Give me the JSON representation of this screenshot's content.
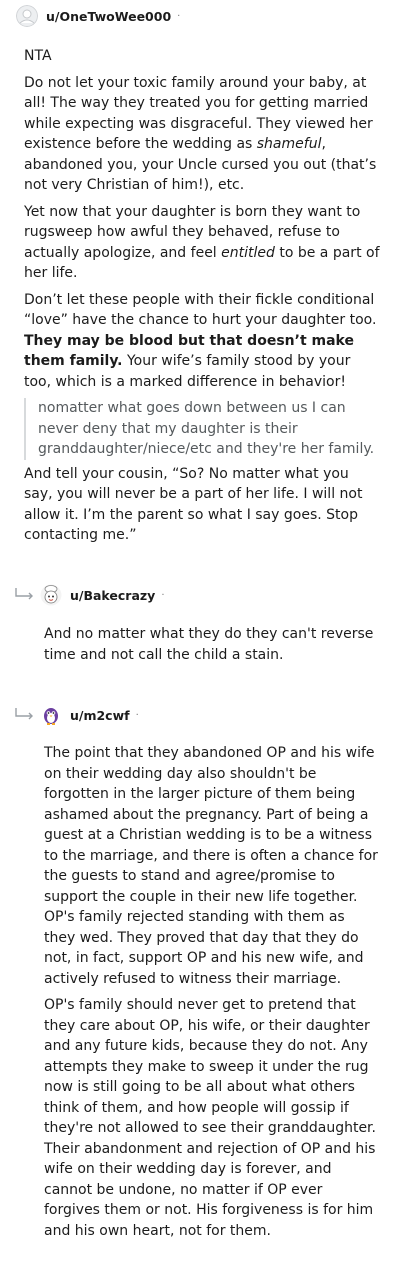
{
  "comments": [
    {
      "username": "u/OneTwoWee000",
      "separator": "·",
      "paragraphs": [
        "NTA",
        "Do not let your toxic family around your baby, at all! The way they treated you for getting married while expecting was disgraceful. They viewed her existence before the wedding as ",
        "Yet now that your daughter is born they want to rugsweep how awful they behaved, refuse to actually apologize, and feel ",
        "Don’t let these people with their fickle conditional “love” have the chance to hurt your daughter too. ",
        "And tell your cousin, “So? No matter what you say, you will never be a part of her life. I will not allow it. I’m the parent so what I say goes. Stop contacting me.”"
      ],
      "p2_italic": "shameful",
      "p2_tail": ", abandoned you, your Uncle cursed you out (that’s not very Christian of him!), etc.",
      "p3_italic": "entitled",
      "p3_tail": " to be a part of her life.",
      "p4_bold": "They may be blood but that doesn’t make them family.",
      "p4_tail": " Your wife’s family stood by your too, which is a marked difference in behavior!",
      "quote": "nomatter what goes down between us I can never deny that my daughter is their granddaughter/niece/etc and they're her family."
    },
    {
      "username": "u/Bakecrazy",
      "separator": "·",
      "text": "And no matter what they do they can't reverse time and not call the child a stain."
    },
    {
      "username": "u/m2cwf",
      "separator": "·",
      "paragraphs": [
        "The point that they abandoned OP and his wife on their wedding day also shouldn't be forgotten in the larger picture of them being ashamed about the pregnancy. Part of being a guest at a Christian wedding is to be a witness to the marriage, and there is often a chance for the guests to stand and agree/promise to support the couple in their new life together. OP's family rejected standing with them as they wed. They proved that day that they do not, in fact, support OP and his new wife, and actively refused to witness their marriage.",
        "OP's family should never get to pretend that they care about OP, his wife, or their daughter and any future kids, because they do not. Any attempts they make to sweep it under the rug now is still going to be all about what others think of them, and how people will gossip if they're not allowed to see their granddaughter. Their abandonment and rejection of OP and his wife on their wedding day is forever, and cannot be undone, no matter if OP ever forgives them or not. His forgiveness is for him and his own heart, not for them."
      ]
    }
  ]
}
